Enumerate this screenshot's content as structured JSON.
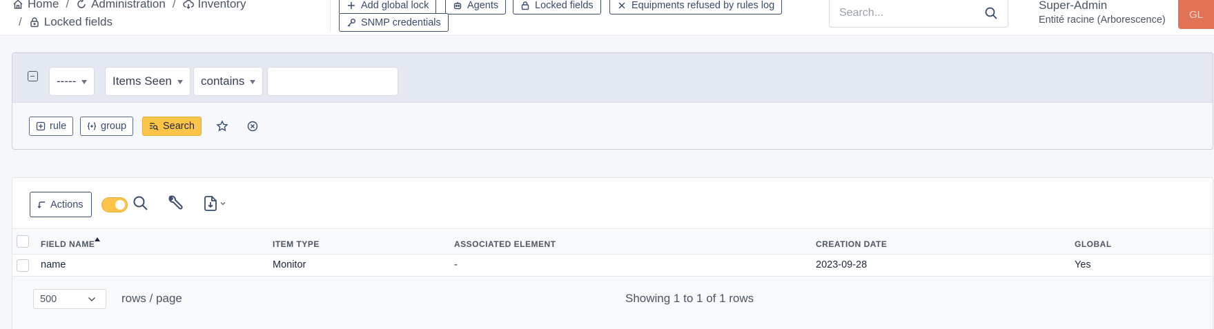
{
  "breadcrumb": {
    "home": "Home",
    "administration": "Administration",
    "inventory": "Inventory",
    "locked_fields": "Locked fields",
    "separator": "/"
  },
  "toolbar": {
    "add_global_lock": "Add global lock",
    "agents": "Agents",
    "locked_fields": "Locked fields",
    "refused_log": "Equipments refused by rules log",
    "snmp_credentials": "SNMP credentials"
  },
  "global_search": {
    "placeholder": "Search..."
  },
  "user": {
    "name": "Super-Admin",
    "entity": "Entité racine (Arborescence)",
    "initials": "GL"
  },
  "criteria": {
    "link_select": "-----",
    "field_select": "Items Seen",
    "operator_select": "contains",
    "value": "",
    "rule_button": "rule",
    "group_button": "group",
    "search_button": "Search"
  },
  "results": {
    "actions_label": "Actions",
    "columns": [
      "FIELD NAME",
      "ITEM TYPE",
      "ASSOCIATED ELEMENT",
      "CREATION DATE",
      "GLOBAL"
    ],
    "rows": [
      [
        "name",
        "Monitor",
        "-",
        "2023-09-28",
        "Yes"
      ]
    ],
    "rows_per_page": "500",
    "rows_per_page_label": "rows / page",
    "showing": "Showing 1 to 1 of 1 rows"
  },
  "colors": {
    "accent_yellow": "#fcc54a",
    "avatar_bg": "#e07256",
    "border_dark": "#3a4b6b"
  }
}
